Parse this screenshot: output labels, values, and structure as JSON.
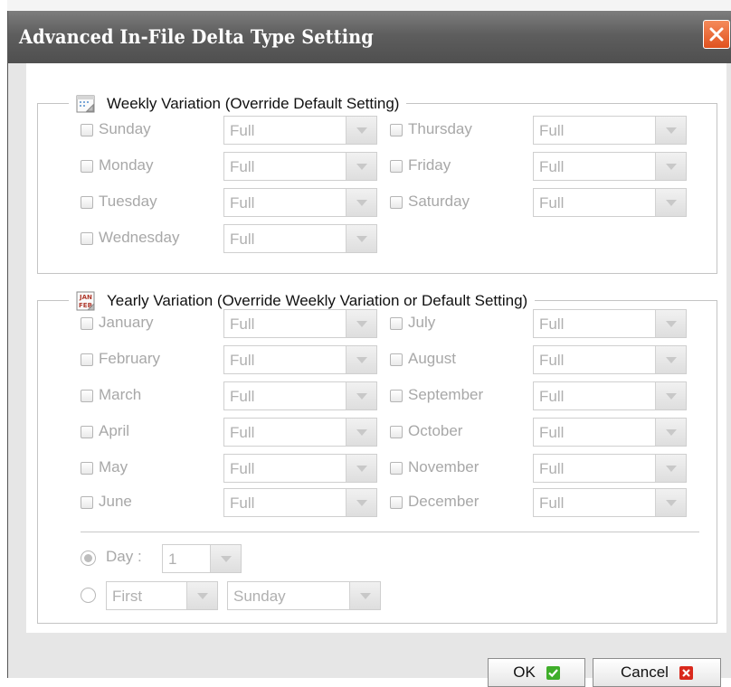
{
  "dialog": {
    "title": "Advanced In-File Delta Type Setting"
  },
  "weekly": {
    "legend": "Weekly Variation (Override Default Setting)",
    "icon": "calendar-week-icon",
    "days": [
      {
        "label": "Sunday",
        "value": "Full"
      },
      {
        "label": "Thursday",
        "value": "Full"
      },
      {
        "label": "Monday",
        "value": "Full"
      },
      {
        "label": "Friday",
        "value": "Full"
      },
      {
        "label": "Tuesday",
        "value": "Full"
      },
      {
        "label": "Saturday",
        "value": "Full"
      },
      {
        "label": "Wednesday",
        "value": "Full"
      }
    ]
  },
  "yearly": {
    "legend": "Yearly Variation (Override Weekly Variation or Default Setting)",
    "icon": "calendar-month-icon",
    "icon_text": [
      "JAN",
      "FEB"
    ],
    "months": [
      {
        "label": "January",
        "value": "Full"
      },
      {
        "label": "July",
        "value": "Full"
      },
      {
        "label": "February",
        "value": "Full"
      },
      {
        "label": "August",
        "value": "Full"
      },
      {
        "label": "March",
        "value": "Full"
      },
      {
        "label": "September",
        "value": "Full"
      },
      {
        "label": "April",
        "value": "Full"
      },
      {
        "label": "October",
        "value": "Full"
      },
      {
        "label": "May",
        "value": "Full"
      },
      {
        "label": "November",
        "value": "Full"
      },
      {
        "label": "June",
        "value": "Full"
      },
      {
        "label": "December",
        "value": "Full"
      }
    ],
    "day_option": {
      "label": "Day :",
      "value": "1",
      "selected": true
    },
    "ordinal_option": {
      "ordinal": "First",
      "weekday": "Sunday",
      "selected": false
    }
  },
  "buttons": {
    "ok": "OK",
    "cancel": "Cancel"
  },
  "colors": {
    "title_bar": "#5e5e5e",
    "close": "#e0521f",
    "ok_icon": "#3fae2a",
    "cancel_icon": "#d9291c",
    "disabled_text": "#a8a8a8"
  }
}
